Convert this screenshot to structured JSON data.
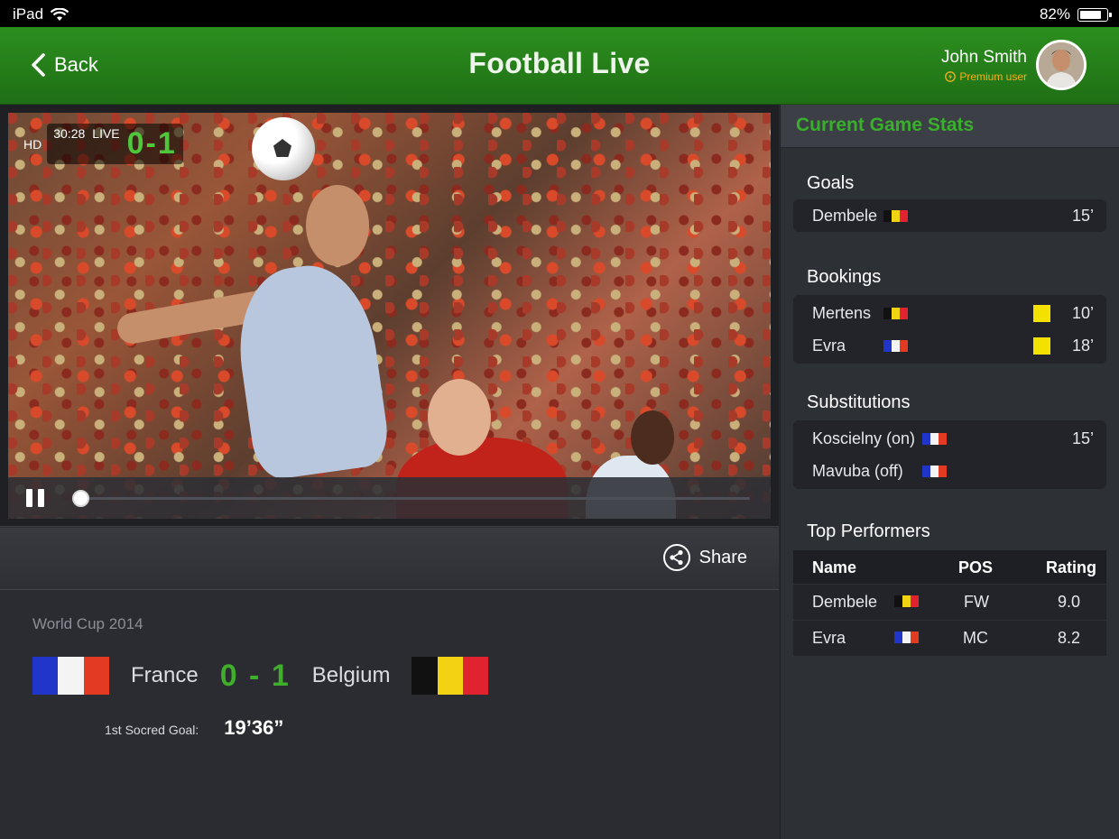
{
  "status_bar": {
    "device": "iPad",
    "battery": "82%",
    "battery_level": 0.82
  },
  "header": {
    "back_label": "Back",
    "title": "Football Live",
    "user_name": "John Smith",
    "user_tier": "Premium user"
  },
  "video": {
    "quality": "HD",
    "time": "30:28",
    "live_label": "LIVE",
    "score": "0-1",
    "progress": 0.01
  },
  "share_label": "Share",
  "match": {
    "tournament": "World Cup 2014",
    "home_team": "France",
    "away_team": "Belgium",
    "score": "0 - 1",
    "first_goal_label": "1st Socred Goal:",
    "first_goal_time": "19’36”"
  },
  "sidebar": {
    "title": "Current Game Stats",
    "goals": {
      "title": "Goals",
      "items": [
        {
          "player": "Dembele",
          "team": "belgium",
          "minute": "15’"
        }
      ]
    },
    "bookings": {
      "title": "Bookings",
      "items": [
        {
          "player": "Mertens",
          "team": "belgium",
          "card": "yellow",
          "minute": "10’"
        },
        {
          "player": "Evra",
          "team": "france",
          "card": "yellow",
          "minute": "18’"
        }
      ]
    },
    "substitutions": {
      "title": "Substitutions",
      "items": [
        {
          "player": "Koscielny (on)",
          "team": "france",
          "minute": "15’"
        },
        {
          "player": "Mavuba (off)",
          "team": "france",
          "minute": ""
        }
      ]
    },
    "top_performers": {
      "title": "Top Performers",
      "columns": [
        "Name",
        "POS",
        "Rating"
      ],
      "rows": [
        {
          "name": "Dembele",
          "team": "belgium",
          "pos": "FW",
          "rating": "9.0"
        },
        {
          "name": "Evra",
          "team": "france",
          "pos": "MC",
          "rating": "8.2"
        }
      ]
    }
  },
  "colors": {
    "accent_green": "#3fae2a",
    "header_green": "#2c8f1f",
    "premium_orange": "#f2b21b",
    "yellow_card": "#f5e100"
  }
}
